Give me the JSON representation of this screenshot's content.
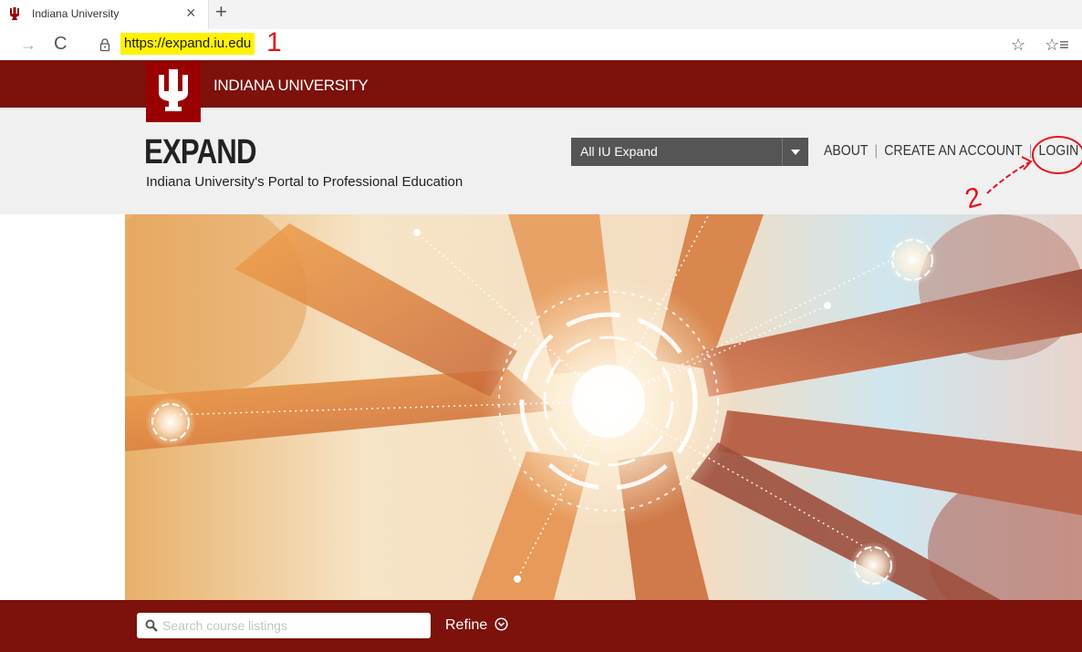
{
  "browser": {
    "tab": {
      "title": "Indiana University",
      "close_glyph": "×",
      "favicon": "iu-trident-icon"
    },
    "new_tab_glyph": "+",
    "address": {
      "url": "https://expand.iu.edu",
      "lock_icon": "lock-icon"
    },
    "icons": {
      "forward": "→",
      "reload": "C",
      "favorite": "☆",
      "favorites": "☆≡"
    }
  },
  "site": {
    "university_name": "INDIANA UNIVERSITY",
    "title": "EXPAND",
    "subtitle": "Indiana University's Portal to Professional Education",
    "site_select": {
      "selected": "All IU Expand"
    },
    "nav": {
      "about": "ABOUT",
      "create_account": "CREATE AN ACCOUNT",
      "login": "LOGIN",
      "separator": "|"
    },
    "search": {
      "placeholder": "Search course listings",
      "value": "",
      "refine_label": "Refine"
    }
  },
  "annotations": {
    "step1": "1",
    "step2": "2"
  },
  "colors": {
    "iu_crimson": "#990000",
    "bar_dark": "#7d110c",
    "header_gray": "#f0f0f0",
    "highlight": "#fff200",
    "annotation_red": "#e8101a"
  }
}
